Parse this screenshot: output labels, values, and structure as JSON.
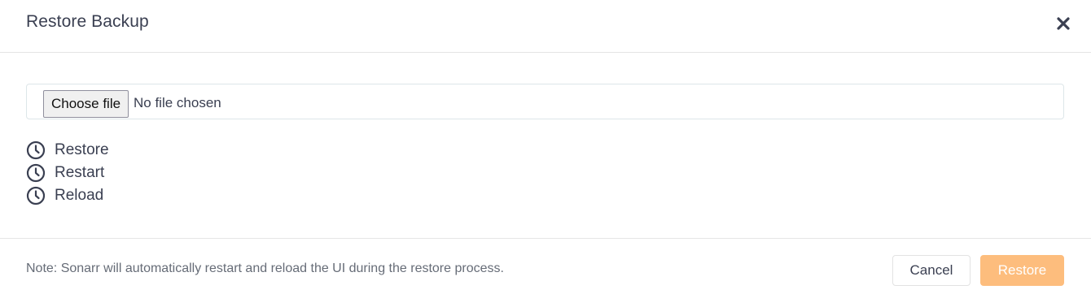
{
  "dialog": {
    "title": "Restore Backup",
    "close_icon": "close-icon"
  },
  "file_input": {
    "button_label": "Choose file",
    "status_text": "No file chosen"
  },
  "steps": [
    {
      "label": "Restore",
      "icon": "clock-icon"
    },
    {
      "label": "Restart",
      "icon": "clock-icon"
    },
    {
      "label": "Reload",
      "icon": "clock-icon"
    }
  ],
  "footer": {
    "note": "Note: Sonarr will automatically restart and reload the UI during the restore process.",
    "cancel_label": "Cancel",
    "restore_label": "Restore"
  },
  "colors": {
    "restore_button_bg": "#fdbd7d",
    "text": "#3a3f51",
    "border": "#e5e5e5"
  }
}
